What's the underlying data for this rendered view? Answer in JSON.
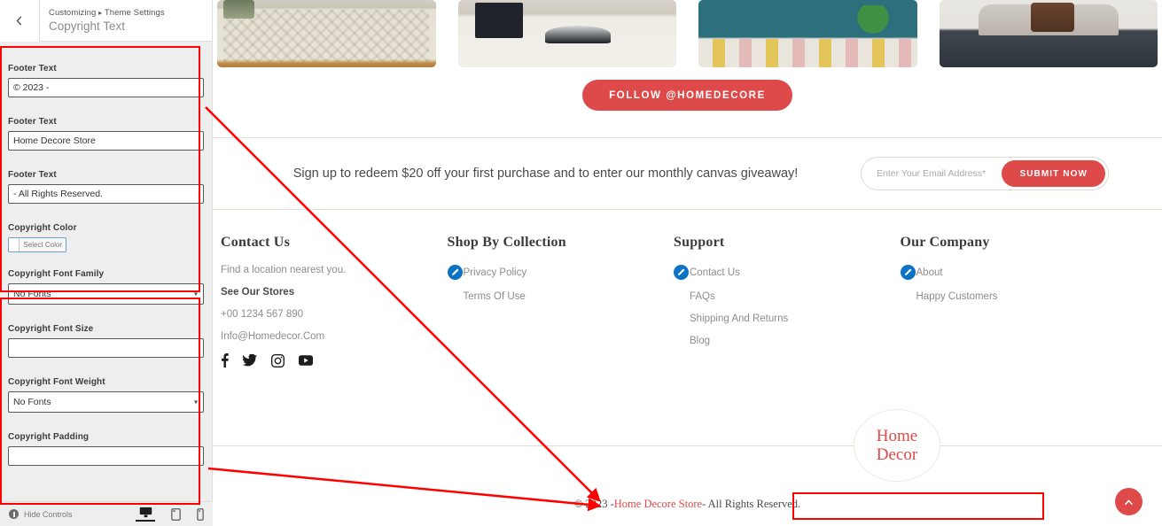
{
  "customizer": {
    "back_icon": "chevron-left-icon",
    "breadcrumb": "Customizing",
    "breadcrumb_caret": "▸",
    "breadcrumb_parent": "Theme Settings",
    "panel_title": "Copyright Text",
    "fields": [
      {
        "label": "Footer Text",
        "value": "© 2023 -",
        "type": "text"
      },
      {
        "label": "Footer Text",
        "value": "Home Decore Store",
        "type": "text"
      },
      {
        "label": "Footer Text",
        "value": "- All Rights Reserved.",
        "type": "text"
      },
      {
        "label": "Copyright Color",
        "value": "",
        "type": "color",
        "button_label": "Select Color",
        "swatch_color": "#ffffff"
      },
      {
        "label": "Copyright Font Family",
        "value": "No Fonts",
        "type": "select"
      },
      {
        "label": "Copyright Font Size",
        "value": "",
        "type": "text"
      },
      {
        "label": "Copyright Font Weight",
        "value": "No Fonts",
        "type": "select"
      },
      {
        "label": "Copyright Padding",
        "value": "",
        "type": "text"
      }
    ],
    "footer_bar": {
      "hide_controls_label": "Hide Controls",
      "devices": [
        {
          "name": "desktop",
          "active": true
        },
        {
          "name": "tablet",
          "active": false
        },
        {
          "name": "mobile",
          "active": false
        }
      ]
    }
  },
  "preview": {
    "gallery": [
      {
        "name": "rug-photo-cream-patterned"
      },
      {
        "name": "rug-photo-living-room-table"
      },
      {
        "name": "rug-photo-striped-teal-wall"
      },
      {
        "name": "rug-photo-dark-dining"
      }
    ],
    "follow_button": "FOLLOW @HOMEDECORE",
    "newsletter": {
      "text": "Sign up to redeem $20 off your first purchase and to enter our monthly canvas giveaway!",
      "placeholder": "Enter Your Email Address*",
      "submit_label": "SUBMIT NOW"
    },
    "columns": [
      {
        "title": "Contact Us",
        "items": [
          {
            "label": "Find a location nearest you.",
            "strong": false,
            "edit": false
          },
          {
            "label": "See Our Stores",
            "strong": true,
            "edit": false
          },
          {
            "label": "+00 1234 567 890",
            "strong": false,
            "edit": false
          },
          {
            "label": "Info@Homedecor.Com",
            "strong": false,
            "edit": false
          }
        ],
        "socials": [
          "facebook-icon",
          "twitter-icon",
          "instagram-icon",
          "youtube-icon"
        ]
      },
      {
        "title": "Shop By Collection",
        "items": [
          {
            "label": "Privacy Policy",
            "strong": false,
            "edit": true
          },
          {
            "label": "Terms Of Use",
            "strong": false,
            "edit": false
          }
        ],
        "socials": []
      },
      {
        "title": "Support",
        "items": [
          {
            "label": "Contact Us",
            "strong": false,
            "edit": true
          },
          {
            "label": "FAQs",
            "strong": false,
            "edit": false
          },
          {
            "label": "Shipping And Returns",
            "strong": false,
            "edit": false
          },
          {
            "label": "Blog",
            "strong": false,
            "edit": false
          }
        ],
        "socials": []
      },
      {
        "title": "Our Company",
        "items": [
          {
            "label": "About",
            "strong": false,
            "edit": true
          },
          {
            "label": "Happy Customers",
            "strong": false,
            "edit": false
          }
        ],
        "socials": []
      }
    ],
    "logo": {
      "line1": "Home",
      "line2": "Decor"
    },
    "copyright": {
      "prefix": "© 2023 -",
      "brand": "Home Decore Store",
      "suffix": "- All Rights Reserved."
    },
    "scroll_top_icon": "chevron-up-icon"
  },
  "colors": {
    "brand_red": "#DE4A4A",
    "logo_red": "#DC4A4A",
    "annotation_red": "#FF0000",
    "edit_blue": "#0B72C4"
  }
}
